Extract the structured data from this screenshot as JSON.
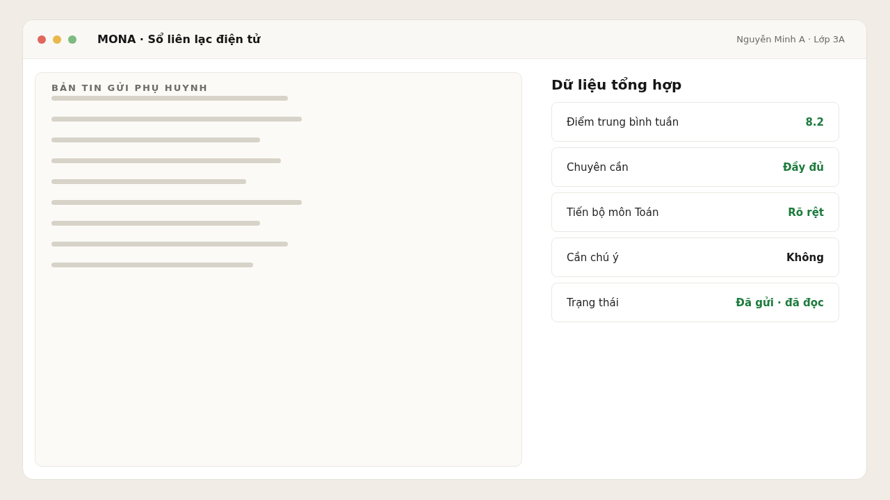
{
  "window": {
    "title": "MONA · Sổ liên lạc điện tử",
    "user_info": "Nguyễn Minh A · Lớp 3A"
  },
  "bulletin": {
    "title": "BẢN TIN GỬI PHỤ HUYNH"
  },
  "summary": {
    "title": "Dữ liệu tổng hợp",
    "items": [
      {
        "label": "Điểm trung bình tuần",
        "value": "8.2",
        "color": "#1e7b3e"
      },
      {
        "label": "Chuyên cần",
        "value": "Đầy đủ",
        "color": "#1e7b3e"
      },
      {
        "label": "Tiến bộ môn Toán",
        "value": "Rõ rệt",
        "color": "#1e7b3e"
      },
      {
        "label": "Cần chú ý",
        "value": "Không",
        "color": "#1a1a1a"
      },
      {
        "label": "Trạng thái",
        "value": "Đã gửi · đã đọc",
        "color": "#1e7b3e"
      }
    ]
  }
}
